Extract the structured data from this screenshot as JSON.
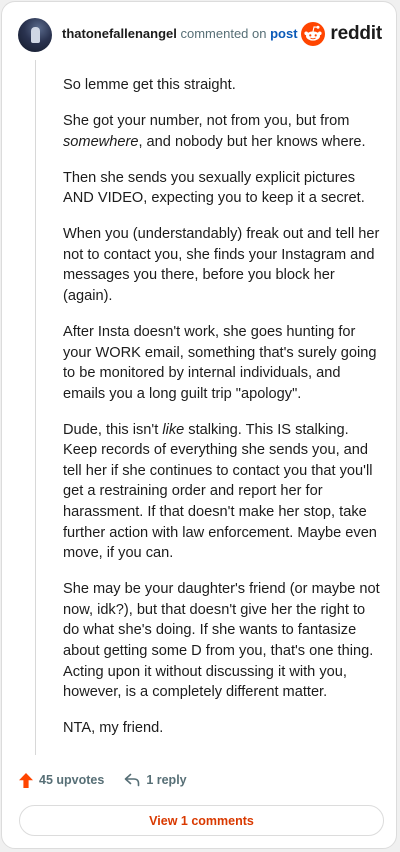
{
  "comment": {
    "username": "thatonefallenangel",
    "action_text": "commented on",
    "post_link": "post",
    "paragraphs": [
      [
        {
          "t": "So lemme get this straight."
        }
      ],
      [
        {
          "t": "She got your number, not from you, but from "
        },
        {
          "t": "somewhere",
          "i": true
        },
        {
          "t": ", and nobody but her knows where."
        }
      ],
      [
        {
          "t": "Then she sends you sexually explicit pictures AND VIDEO, expecting you to keep it a secret."
        }
      ],
      [
        {
          "t": "When you (understandably) freak out and tell her not to contact you, she finds your Instagram and messages you there, before you block her (again)."
        }
      ],
      [
        {
          "t": "After Insta doesn't work, she goes hunting for your WORK email, something that's surely going to be monitored by internal individuals, and emails you a long guilt trip \"apology\"."
        }
      ],
      [
        {
          "t": "Dude, this isn't "
        },
        {
          "t": "like",
          "i": true
        },
        {
          "t": " stalking. This IS stalking. Keep records of everything she sends you, and tell her if she continues to contact you that you'll get a restraining order and report her for harassment. If that doesn't make her stop, take further action with law enforcement. Maybe even move, if you can."
        }
      ],
      [
        {
          "t": "She may be your daughter's friend (or maybe not now, idk?), but that doesn't give her the right to do what she's doing. If she wants to fantasize about getting some D from you, that's one thing. Acting upon it without discussing it with you, however, is a completely different matter."
        }
      ],
      [
        {
          "t": "NTA, my friend."
        }
      ]
    ]
  },
  "brand": {
    "name": "reddit",
    "icon": "reddit-logo-icon",
    "color": "#ff4500"
  },
  "actions": {
    "upvotes_label": "45 upvotes",
    "reply_label": "1 reply",
    "upvote_icon": "upvote-arrow-icon",
    "reply_icon": "reply-arrow-icon",
    "upvote_color": "#ff4500"
  },
  "view_comments_label": "View 1 comments",
  "colors": {
    "link": "#0a5ab8",
    "accent": "#d93900",
    "muted": "#576f76"
  }
}
